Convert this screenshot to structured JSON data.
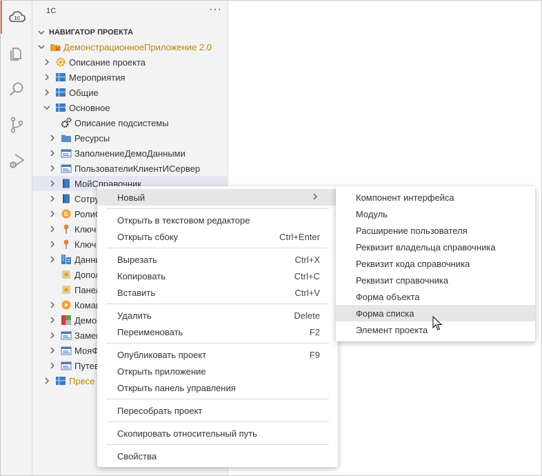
{
  "sidebar": {
    "title": "1С",
    "more": "···",
    "section_title": "НАВИГАТОР ПРОЕКТА",
    "tree": [
      {
        "label": "ДемонстрационноеПриложение 2.0",
        "icon": "project-1c-icon",
        "level": 0,
        "expanded": true,
        "brand": true
      },
      {
        "label": "Описание проекта",
        "icon": "gear-icon",
        "level": 1,
        "expanded": false
      },
      {
        "label": "Мероприятия",
        "icon": "subsystem-icon",
        "level": 1,
        "expanded": false
      },
      {
        "label": "Общие",
        "icon": "subsystem-icon",
        "level": 1,
        "expanded": false
      },
      {
        "label": "Основное",
        "icon": "subsystem-icon",
        "level": 1,
        "expanded": true
      },
      {
        "label": "Описание подсистемы",
        "icon": "gears-icon",
        "level": 2,
        "leaf": true
      },
      {
        "label": "Ресурсы",
        "icon": "folder-icon",
        "level": 2,
        "expanded": false
      },
      {
        "label": "ЗаполнениеДемоДанными",
        "icon": "module-icon",
        "level": 2,
        "expanded": false
      },
      {
        "label": "ПользователиКлиентИСервер",
        "icon": "module-icon",
        "level": 2,
        "expanded": false
      },
      {
        "label": "МойСправочник",
        "icon": "catalog-book-icon",
        "level": 2,
        "expanded": false,
        "selected": true
      },
      {
        "label": "Сотру",
        "icon": "catalog-book-icon",
        "level": 2,
        "expanded": false
      },
      {
        "label": "РолиС",
        "icon": "role-coin-icon",
        "level": 2,
        "expanded": false
      },
      {
        "label": "Ключ",
        "icon": "key-pin-icon",
        "level": 2,
        "expanded": false
      },
      {
        "label": "Ключ",
        "icon": "key-pin-icon",
        "level": 2,
        "expanded": false
      },
      {
        "label": "Данны",
        "icon": "building-icon",
        "level": 2,
        "expanded": false
      },
      {
        "label": "Допол",
        "icon": "panel-icon",
        "level": 2,
        "leaf": true
      },
      {
        "label": "Панел",
        "icon": "panel-icon",
        "level": 2,
        "leaf": true
      },
      {
        "label": "Коман",
        "icon": "command-play-icon",
        "level": 2,
        "expanded": false
      },
      {
        "label": "Демо",
        "icon": "colors-icon",
        "level": 2,
        "expanded": false
      },
      {
        "label": "Замен",
        "icon": "module-icon",
        "level": 2,
        "expanded": false
      },
      {
        "label": "МояФ",
        "icon": "module-icon",
        "level": 2,
        "expanded": false
      },
      {
        "label": "Путев",
        "icon": "module-icon",
        "level": 2,
        "expanded": false
      },
      {
        "label": "Пресе",
        "icon": "subsystem-icon",
        "level": 1,
        "expanded": false,
        "brand": true
      }
    ]
  },
  "context_menu": {
    "groups": [
      [
        {
          "label": "Новый",
          "shortcut": "",
          "submenu": true,
          "hover": true
        }
      ],
      [
        {
          "label": "Открыть в текстовом редакторе",
          "shortcut": ""
        },
        {
          "label": "Открыть сбоку",
          "shortcut": "Ctrl+Enter"
        }
      ],
      [
        {
          "label": "Вырезать",
          "shortcut": "Ctrl+X"
        },
        {
          "label": "Копировать",
          "shortcut": "Ctrl+C"
        },
        {
          "label": "Вставить",
          "shortcut": "Ctrl+V"
        }
      ],
      [
        {
          "label": "Удалить",
          "shortcut": "Delete"
        },
        {
          "label": "Переименовать",
          "shortcut": "F2"
        }
      ],
      [
        {
          "label": "Опубликовать проект",
          "shortcut": "F9"
        },
        {
          "label": "Открыть приложение",
          "shortcut": ""
        },
        {
          "label": "Открыть панель управления",
          "shortcut": ""
        }
      ],
      [
        {
          "label": "Пересобрать проект",
          "shortcut": ""
        }
      ],
      [
        {
          "label": "Скопировать относительный путь",
          "shortcut": ""
        }
      ],
      [
        {
          "label": "Свойства",
          "shortcut": ""
        }
      ]
    ]
  },
  "submenu": {
    "items": [
      {
        "label": "Компонент интерфейса"
      },
      {
        "label": "Модуль"
      },
      {
        "label": "Расширение пользователя"
      },
      {
        "label": "Реквизит владельца справочника"
      },
      {
        "label": "Реквизит кода справочника"
      },
      {
        "label": "Реквизит справочника"
      },
      {
        "label": "Форма объекта"
      },
      {
        "label": "Форма списка",
        "hover": true
      },
      {
        "label": "Элемент проекта"
      }
    ]
  },
  "activity_bar": [
    "cloud-1c-icon",
    "files-icon",
    "search-icon",
    "source-control-icon",
    "run-debug-icon"
  ],
  "colors": {
    "accent": "#e46f3f",
    "brand_text": "#b8860b",
    "selection": "#e4e6f1",
    "hover": "#e6e6e6"
  }
}
